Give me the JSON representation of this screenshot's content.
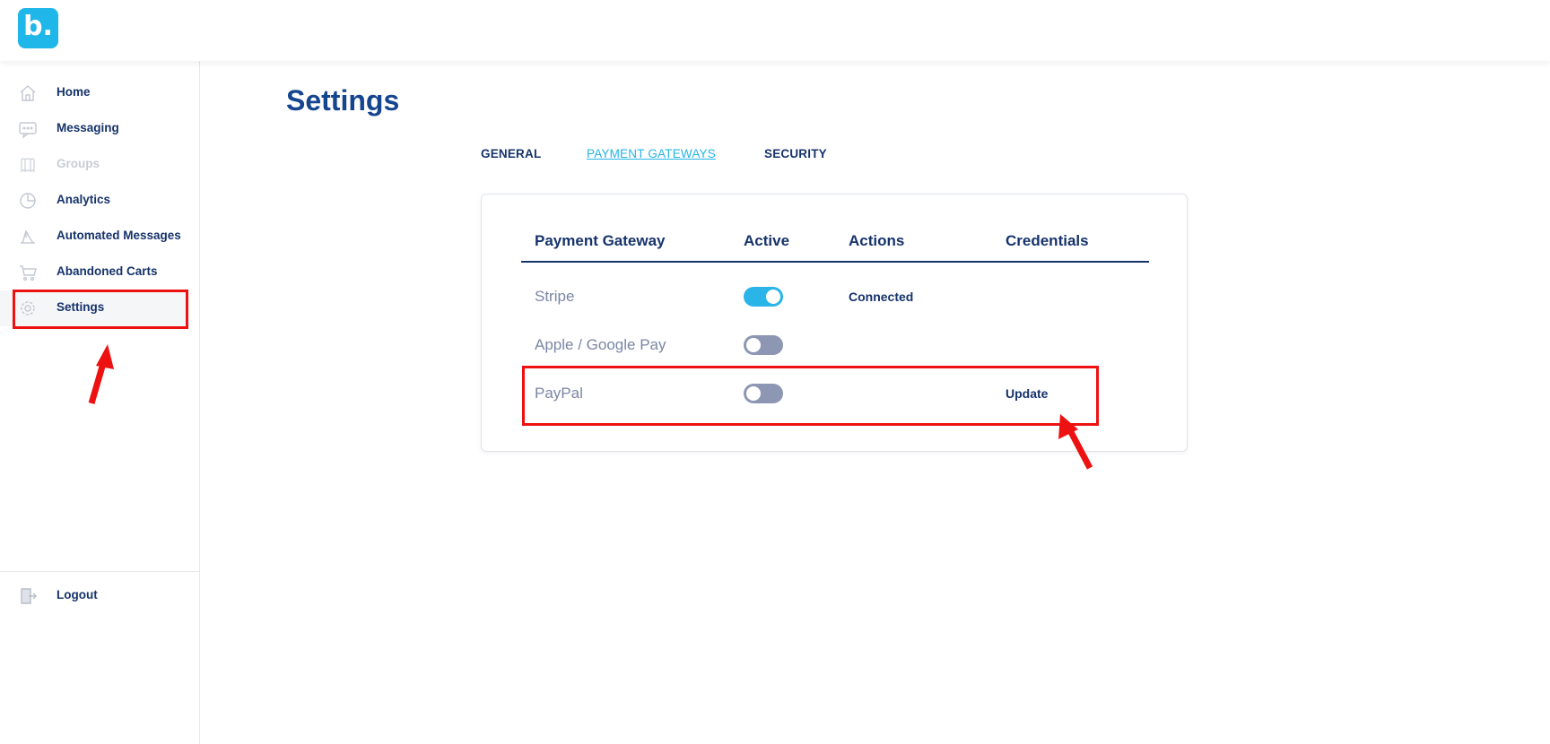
{
  "app": {
    "logo_text": "b."
  },
  "sidebar": {
    "items": [
      {
        "label": "Home",
        "icon": "home-icon"
      },
      {
        "label": "Messaging",
        "icon": "message-icon"
      },
      {
        "label": "Groups",
        "icon": "groups-icon"
      },
      {
        "label": "Analytics",
        "icon": "pie-chart-icon"
      },
      {
        "label": "Automated Messages",
        "icon": "automation-icon"
      },
      {
        "label": "Abandoned Carts",
        "icon": "cart-icon"
      },
      {
        "label": "Settings",
        "icon": "gear-icon"
      }
    ],
    "logout": {
      "label": "Logout",
      "icon": "logout-icon"
    }
  },
  "main": {
    "title": "Settings",
    "tabs": [
      {
        "label": "GENERAL",
        "active": false
      },
      {
        "label": "PAYMENT GATEWAYS",
        "active": true
      },
      {
        "label": "SECURITY",
        "active": false
      }
    ],
    "table": {
      "headers": [
        "Payment Gateway",
        "Active",
        "Actions",
        "Credentials"
      ],
      "rows": [
        {
          "name": "Stripe",
          "active": true,
          "action": "Connected",
          "credentials": ""
        },
        {
          "name": "Apple / Google Pay",
          "active": false,
          "action": "",
          "credentials": ""
        },
        {
          "name": "PayPal",
          "active": false,
          "action": "",
          "credentials": "Update"
        }
      ]
    }
  },
  "colors": {
    "brand": "#1fb6ea",
    "navy": "#16336b",
    "toggle_on": "#2bb4e8",
    "toggle_off": "#8d97b3",
    "annotation": "#ee1111"
  }
}
